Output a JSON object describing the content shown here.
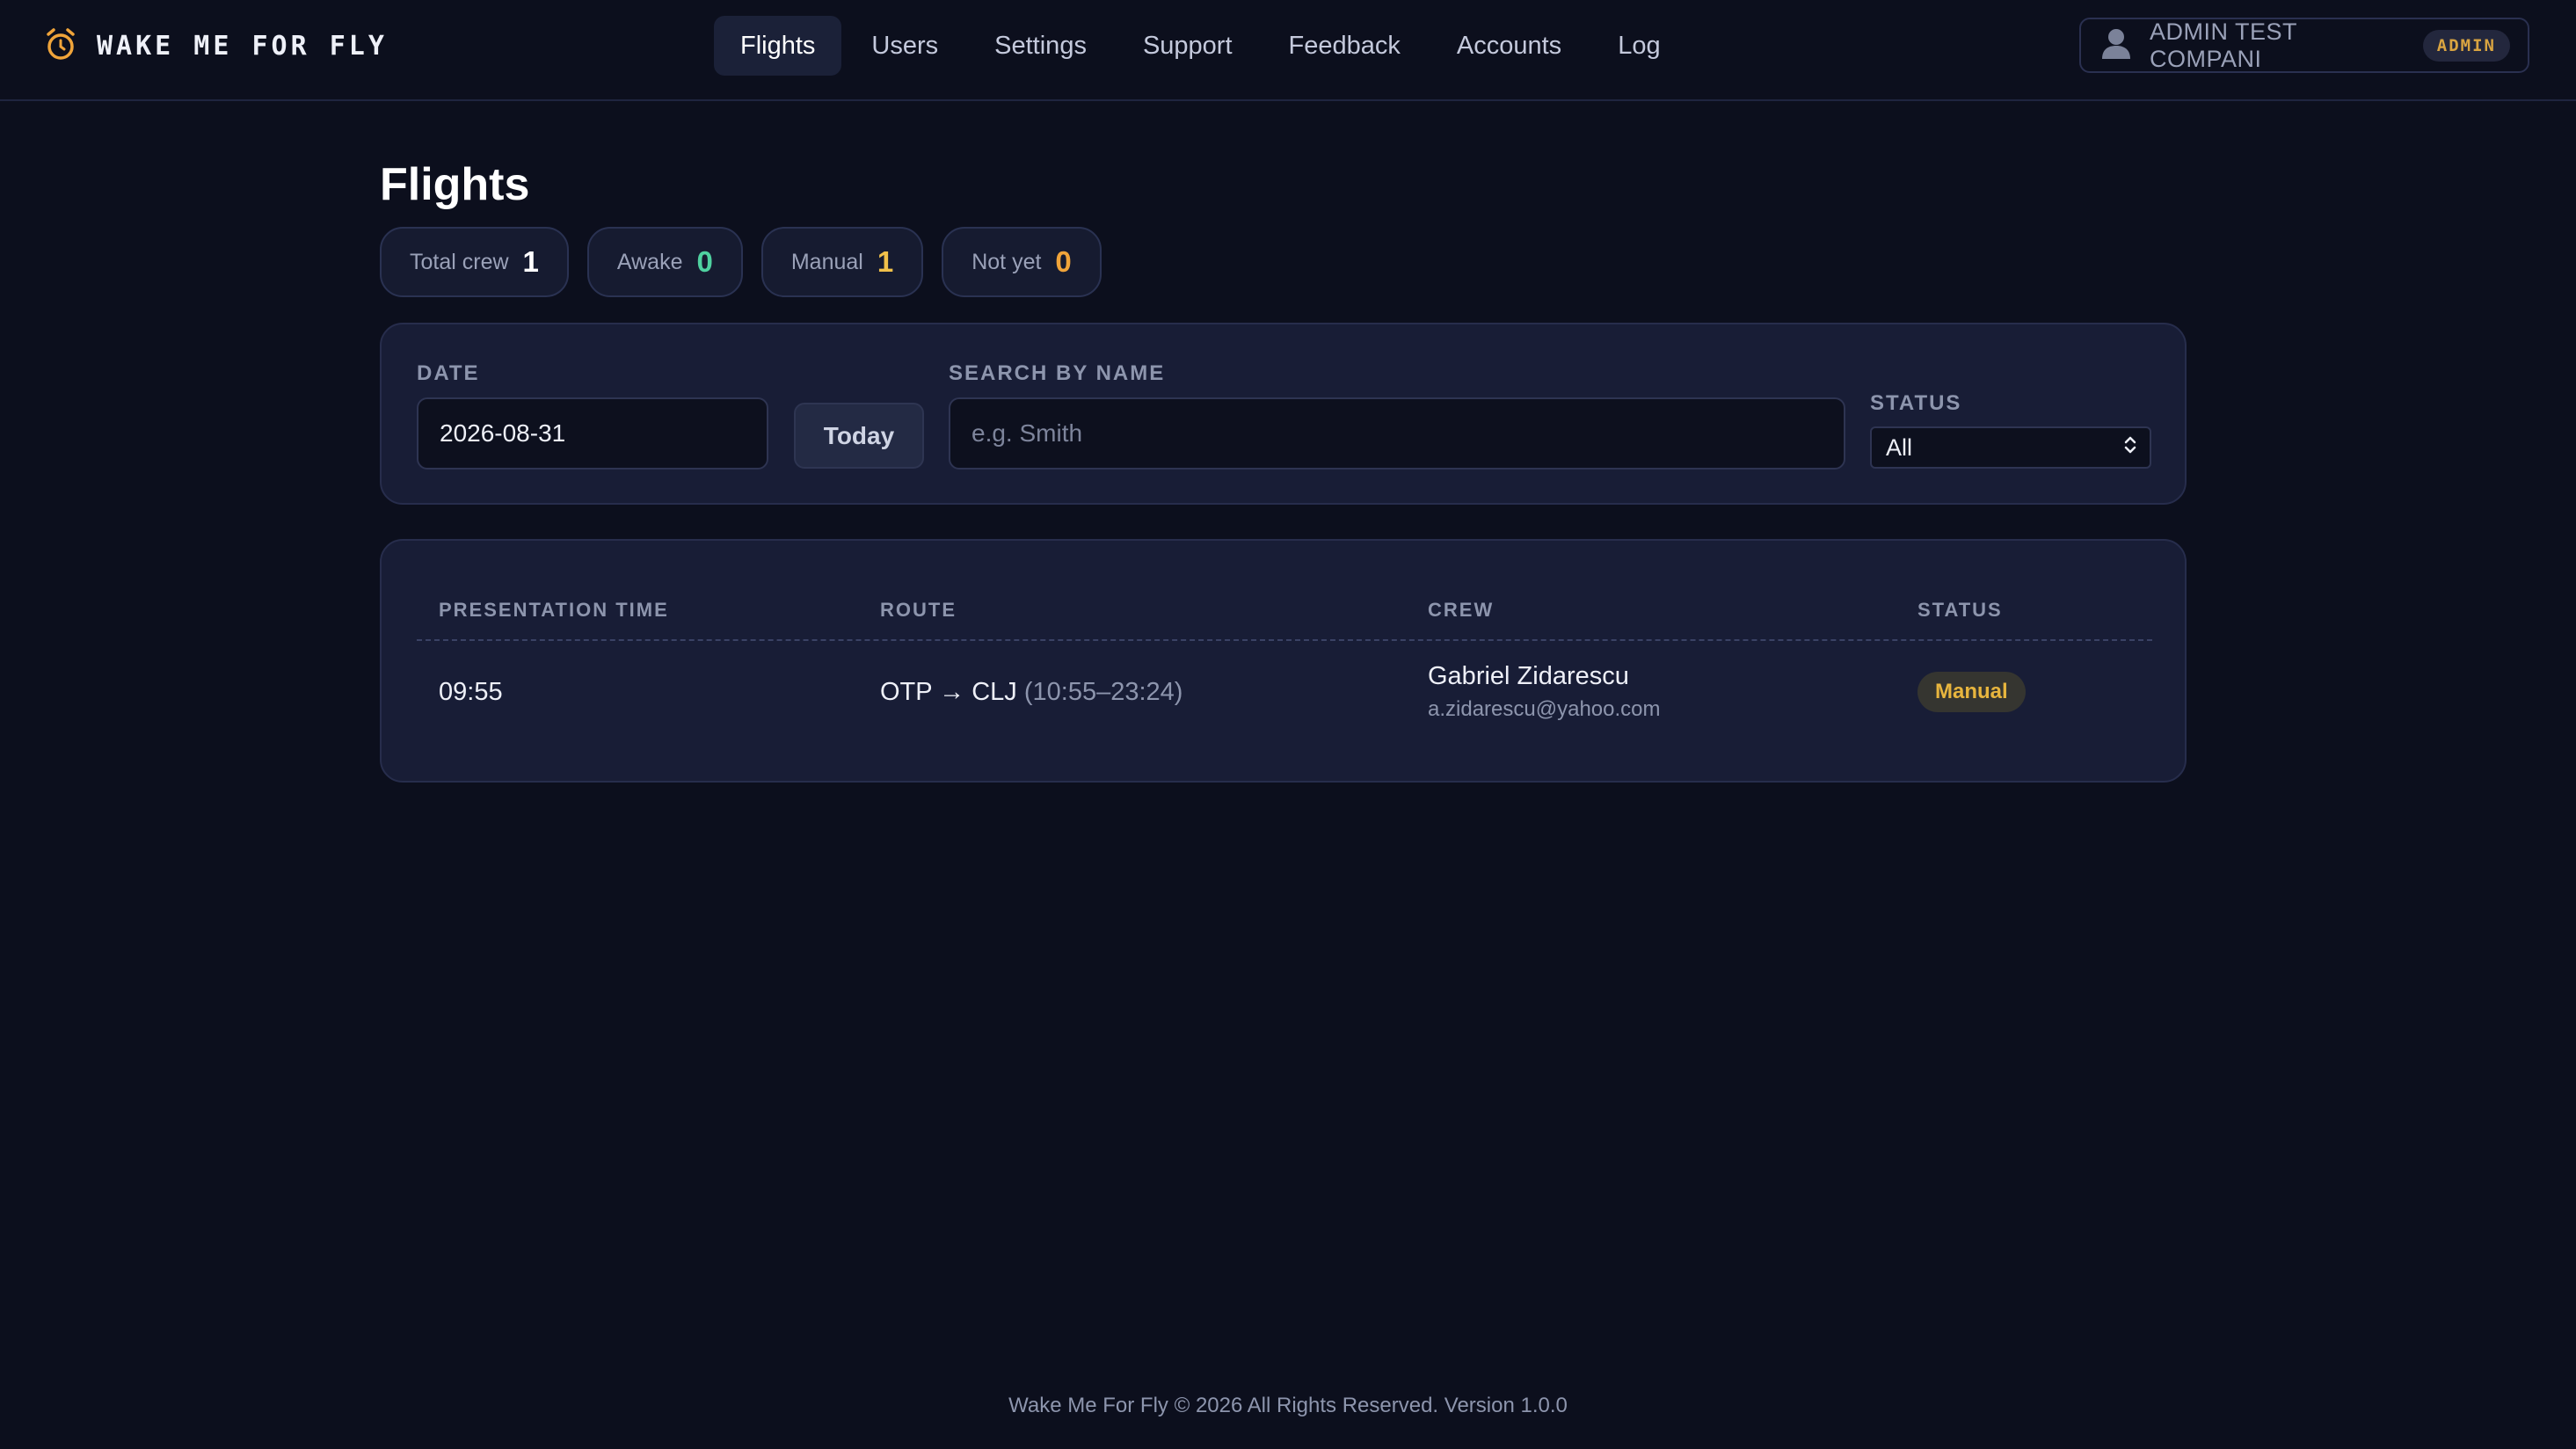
{
  "brand": {
    "name": "WAKE ME FOR FLY",
    "icon": "alarm-clock-icon",
    "accent": "#f0a43a"
  },
  "nav": {
    "items": [
      {
        "label": "Flights",
        "active": true
      },
      {
        "label": "Users"
      },
      {
        "label": "Settings"
      },
      {
        "label": "Support"
      },
      {
        "label": "Feedback"
      },
      {
        "label": "Accounts"
      },
      {
        "label": "Log"
      }
    ]
  },
  "user": {
    "name": "ADMIN TEST COMPANI",
    "role": "ADMIN",
    "icon": "user-icon"
  },
  "page": {
    "title": "Flights"
  },
  "stats": [
    {
      "label": "Total crew",
      "value": "1",
      "color": "#ffffff"
    },
    {
      "label": "Awake",
      "value": "0",
      "color": "#4fd1a0"
    },
    {
      "label": "Manual",
      "value": "1",
      "color": "#f0c04a"
    },
    {
      "label": "Not yet",
      "value": "0",
      "color": "#f0a43a"
    }
  ],
  "filters": {
    "date_label": "DATE",
    "date_value": "2026-08-31",
    "today_label": "Today",
    "search_label": "SEARCH BY NAME",
    "search_placeholder": "e.g. Smith",
    "status_label": "STATUS",
    "status_value": "All"
  },
  "table": {
    "columns": [
      "PRESENTATION TIME",
      "ROUTE",
      "CREW",
      "STATUS"
    ],
    "rows": [
      {
        "time": "09:55",
        "route": "OTP → CLJ",
        "route_times": "(10:55–23:24)",
        "crew_name": "Gabriel Zidarescu",
        "crew_email": "a.zidarescu@yahoo.com",
        "status": "Manual",
        "status_color": "#e7b53e"
      }
    ]
  },
  "footer": {
    "text": "Wake Me For Fly © 2026 All Rights Reserved. Version 1.0.0"
  }
}
